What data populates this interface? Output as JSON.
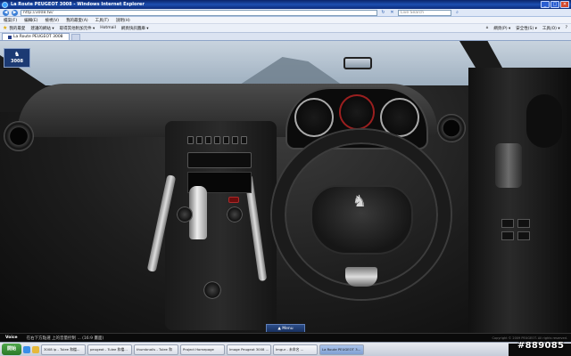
{
  "window": {
    "title": "La Route PEUGEOT 3008 - Windows Internet Explorer"
  },
  "address": {
    "url": "http://3008.tw/",
    "search_placeholder": "Live Search"
  },
  "menu": {
    "items": [
      "檔案(F)",
      "編輯(E)",
      "檢視(V)",
      "我的最愛(A)",
      "工具(T)",
      "說明(H)"
    ]
  },
  "favorites": {
    "label": "我的最愛",
    "items": [
      "建議的網站 ▾",
      "取得其他附加元件 ▾",
      "Hotmail",
      "網頁快訊圖庫 ▾"
    ],
    "right_items": [
      "網頁(P) ▾",
      "安全性(S) ▾",
      "工具(O) ▾"
    ]
  },
  "tab": {
    "label": "La Route PEUGEOT 3008"
  },
  "page": {
    "brand": "3008",
    "menu_label": "▲ Menu",
    "voice_label": "Voice",
    "voice_text": "在右下方點選 上的音量控制 ... (16:9 畫面)",
    "copyright": "Copyright © 2009 PEUGEOT. All rights reserved."
  },
  "taskbar": {
    "start_label": "開始",
    "items": [
      "3008 ip - Tulee 和檔...",
      "peugeot - Tulee 和檔...",
      "thumbnails - Tulee 和",
      "Project Homepage",
      "Image Peugeot 3008 ...",
      "Imgur - 未命名 ...",
      "La Route PEUGEOT 3..."
    ]
  },
  "watermark": "#889085",
  "colors": {
    "titlebar": "#0a246a",
    "menu_button": "#2c4e8a"
  }
}
